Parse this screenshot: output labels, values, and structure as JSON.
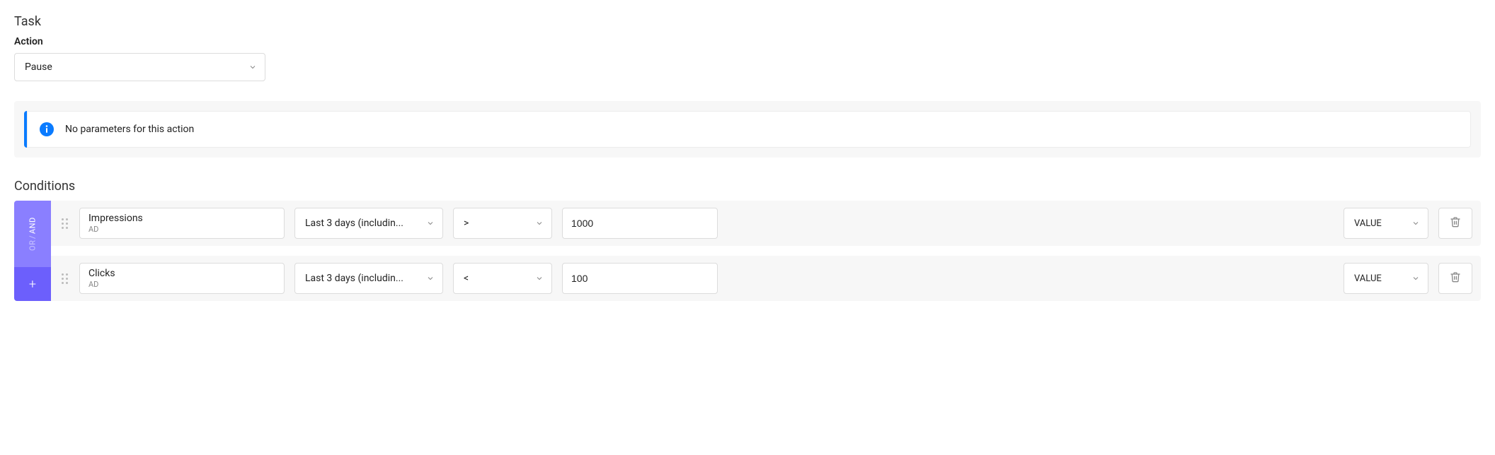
{
  "task": {
    "heading": "Task",
    "action_label": "Action",
    "action_value": "Pause"
  },
  "info": {
    "text": "No parameters for this action"
  },
  "conditions": {
    "heading": "Conditions",
    "andor": {
      "and": "AND",
      "or": "OR",
      "add": "+"
    },
    "rows": [
      {
        "metric": "Impressions",
        "level": "AD",
        "timeframe": "Last 3 days (includin...",
        "operator": ">",
        "value": "1000",
        "type": "VALUE"
      },
      {
        "metric": "Clicks",
        "level": "AD",
        "timeframe": "Last 3 days (includin...",
        "operator": "<",
        "value": "100",
        "type": "VALUE"
      }
    ]
  }
}
